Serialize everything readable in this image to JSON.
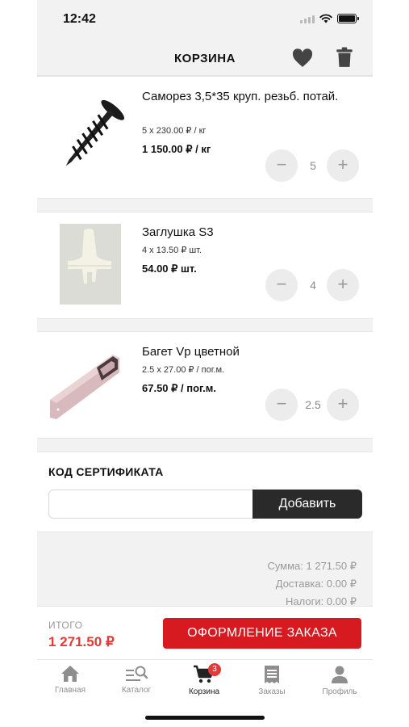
{
  "status": {
    "time": "12:42"
  },
  "header": {
    "title": "КОРЗИНА"
  },
  "items": [
    {
      "name": "Саморез 3,5*35 круп. резьб. потай.",
      "price_line": "5 x 230.00 ₽ / кг",
      "total": "1 150.00 ₽ / кг",
      "qty": "5"
    },
    {
      "name": "Заглушка S3",
      "price_line": "4 x 13.50 ₽ шт.",
      "total": "54.00 ₽ шт.",
      "qty": "4"
    },
    {
      "name": "Багет Vp цветной",
      "price_line": "2.5 x 27.00 ₽ / пог.м.",
      "total": "67.50 ₽ / пог.м.",
      "qty": "2.5"
    }
  ],
  "controls": {
    "minus": "−",
    "plus": "+"
  },
  "certificate": {
    "title": "КОД СЕРТИФИКАТА",
    "value": "",
    "button": "Добавить"
  },
  "summary": {
    "sum": "Сумма: 1 271.50 ₽",
    "delivery": "Доставка: 0.00 ₽",
    "taxes": "Налоги: 0.00 ₽"
  },
  "checkout": {
    "total_label": "ИТОГО",
    "total_value": "1 271.50 ₽",
    "button": "ОФОРМЛЕНИЕ ЗАКАЗА"
  },
  "tabs": [
    {
      "label": "Главная",
      "icon": "home-icon"
    },
    {
      "label": "Каталог",
      "icon": "catalog-search-icon"
    },
    {
      "label": "Корзина",
      "icon": "cart-icon",
      "badge": "3",
      "active": true
    },
    {
      "label": "Заказы",
      "icon": "orders-icon"
    },
    {
      "label": "Профиль",
      "icon": "profile-icon"
    }
  ],
  "colors": {
    "accent": "#d71920",
    "total": "#e53935",
    "dark_button": "#2a2a2a",
    "background": "#f2f2f2"
  }
}
